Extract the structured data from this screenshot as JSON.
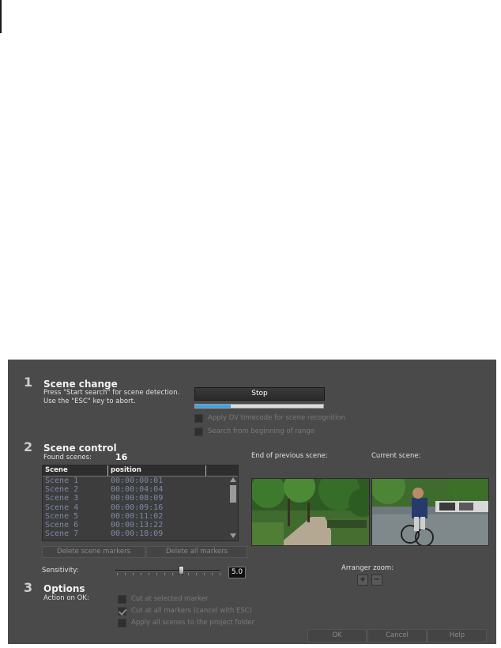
{
  "step1": {
    "number": "1",
    "title": "Scene change",
    "hint_line1": "Press \"Start search\" for scene detection.",
    "hint_line2": "Use the \"ESC\" key to abort.",
    "stop_label": "Stop",
    "progress": 0.28,
    "option_dv_timecode": "Apply DV timecode for scene recognition",
    "option_search_beginning": "Search from beginning of range"
  },
  "step2": {
    "number": "2",
    "title": "Scene control",
    "found_label": "Found scenes:",
    "found_count": "16",
    "col_scene": "Scene",
    "col_position": "position",
    "rows": [
      {
        "scene": "Scene 1",
        "position": "00:00:00:01"
      },
      {
        "scene": "Scene 2",
        "position": "00:00:04:04"
      },
      {
        "scene": "Scene 3",
        "position": "00:00:08:09"
      },
      {
        "scene": "Scene 4",
        "position": "00:00:09:16"
      },
      {
        "scene": "Scene 5",
        "position": "00:00:11:02"
      },
      {
        "scene": "Scene 6",
        "position": "00:00:13:22"
      },
      {
        "scene": "Scene 7",
        "position": "00:00:18:09"
      }
    ],
    "delete_markers_label": "Delete scene markers",
    "delete_all_label": "Delete all markers",
    "end_prev_label": "End of previous scene:",
    "current_label": "Current scene:",
    "sensitivity_label": "Sensitivity:",
    "sensitivity_value": "5.0",
    "sensitivity_fraction": 0.5,
    "arranger_zoom_label": "Arranger zoom:",
    "zoom_plus": "+",
    "zoom_minus": "−"
  },
  "step3": {
    "number": "3",
    "title": "Options",
    "action_label": "Action on OK:",
    "opt_cut_selected": "Cut at selected marker",
    "opt_cut_all": "Cut at all markers (cancel with ESC)",
    "opt_apply_scenes": "Apply all scenes to the project folder"
  },
  "buttons": {
    "ok": "OK",
    "cancel": "Cancel",
    "help": "Help"
  },
  "colors": {
    "dialog_bg": "#4a4a4a",
    "progress_fill": "#3ea6e2",
    "list_text": "#7b8aa6"
  }
}
